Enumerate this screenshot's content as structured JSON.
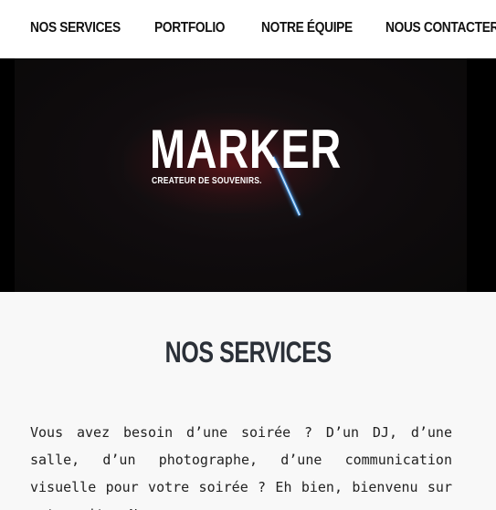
{
  "nav": {
    "items": [
      {
        "label": "NOS SERVICES"
      },
      {
        "label": "PORTFOLIO"
      },
      {
        "label": "NOTRE ÉQUIPE"
      },
      {
        "label": "NOUS CONTACTER"
      }
    ]
  },
  "hero": {
    "logo_text": "MARKER",
    "tagline": "CREATEUR DE SOUVENIRS."
  },
  "section": {
    "title": "NOS SERVICES",
    "intro": "Vous avez besoin d’une soirée ? D’un DJ, d’une salle, d’un photographe, d’une communication visuelle pour votre soirée ? Eh bien, bienvenu sur notre site. Nous sommes"
  },
  "colors": {
    "title": "#2b3038",
    "nav_text": "#121212",
    "hero_bg": "#000000",
    "accent_red": "#e0222c",
    "accent_blue": "#4aa8ff"
  }
}
